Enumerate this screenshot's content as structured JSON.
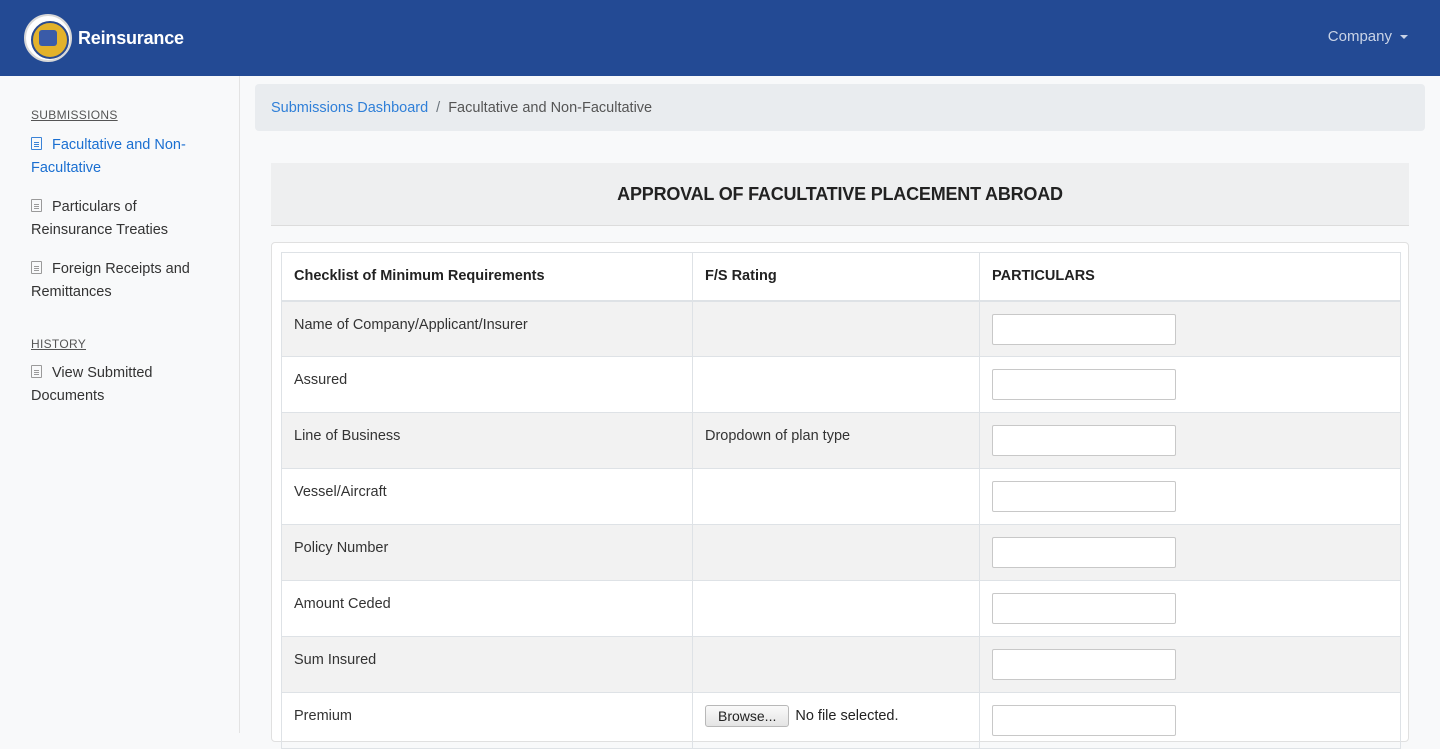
{
  "navbar": {
    "brand": "Reinsurance",
    "company_menu": "Company",
    "brand_color": "#234a94"
  },
  "sidebar": {
    "submissions_heading": "SUBMISSIONS",
    "items": [
      {
        "label": "Facultative and Non-Facultative",
        "icon": "document-icon",
        "active": true
      },
      {
        "label": "Particulars of Reinsurance Treaties",
        "icon": "document-icon",
        "active": false
      },
      {
        "label": "Foreign Receipts and Remittances",
        "icon": "document-icon",
        "active": false
      }
    ],
    "history_heading": "HISTORY",
    "history_items": [
      {
        "label": "View Submitted Documents",
        "icon": "document-icon",
        "active": false
      }
    ]
  },
  "breadcrumb": {
    "parent": "Submissions Dashboard",
    "separator": "/",
    "current": "Facultative and Non-Facultative"
  },
  "form": {
    "title": "APPROVAL OF FACULTATIVE PLACEMENT ABROAD",
    "columns": [
      "Checklist of Minimum Requirements",
      "F/S Rating",
      "PARTICULARS"
    ],
    "rows": [
      {
        "requirement": "Name of Company/Applicant/Insurer",
        "rating": ""
      },
      {
        "requirement": "Assured",
        "rating": ""
      },
      {
        "requirement": "Line of Business",
        "rating": "Dropdown of plan type"
      },
      {
        "requirement": "Vessel/Aircraft",
        "rating": ""
      },
      {
        "requirement": "Policy Number",
        "rating": ""
      },
      {
        "requirement": "Amount Ceded",
        "rating": ""
      },
      {
        "requirement": "Sum Insured",
        "rating": ""
      },
      {
        "requirement": "Premium",
        "rating": ""
      }
    ],
    "file_input": {
      "button_label": "Browse...",
      "status": "No file selected."
    }
  }
}
